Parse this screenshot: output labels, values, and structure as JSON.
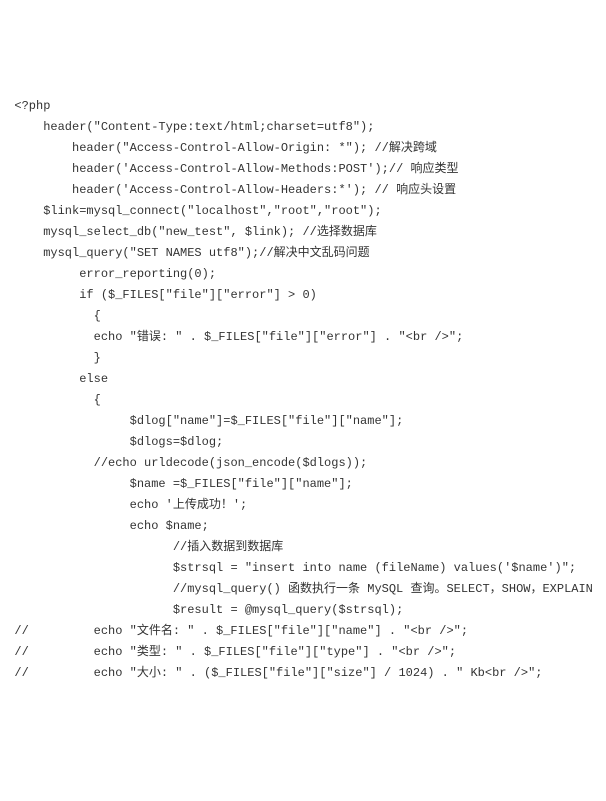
{
  "code": {
    "lines": [
      "  <?php",
      "      header(\"Content-Type:text/html;charset=utf8\");",
      "          header(\"Access-Control-Allow-Origin: *\"); //解决跨域",
      "          header('Access-Control-Allow-Methods:POST');// 响应类型",
      "          header('Access-Control-Allow-Headers:*'); // 响应头设置",
      "      $link=mysql_connect(\"localhost\",\"root\",\"root\");",
      "      mysql_select_db(\"new_test\", $link); //选择数据库",
      "      mysql_query(\"SET NAMES utf8\");//解决中文乱码问题",
      "           error_reporting(0);",
      "           if ($_FILES[\"file\"][\"error\"] > 0)",
      "             {",
      "             echo \"错误: \" . $_FILES[\"file\"][\"error\"] . \"<br />\";",
      "             }",
      "           else",
      "             {",
      "                  $dlog[\"name\"]=$_FILES[\"file\"][\"name\"];",
      "                  $dlogs=$dlog;",
      "             //echo urldecode(json_encode($dlogs));",
      "                  $name =$_FILES[\"file\"][\"name\"];",
      "                  echo '上传成功！';",
      "                  echo $name;",
      "                        //插入数据到数据库",
      "                        $strsql = \"insert into name (fileName) values('$name')\";",
      "                        //mysql_query() 函数执行一条 MySQL 查询。SELECT，SHOW，EXPLAIN",
      "                        $result = @mysql_query($strsql);",
      "  //         echo \"文件名: \" . $_FILES[\"file\"][\"name\"] . \"<br />\";",
      "  //         echo \"类型: \" . $_FILES[\"file\"][\"type\"] . \"<br />\";",
      "  //         echo \"大小: \" . ($_FILES[\"file\"][\"size\"] / 1024) . \" Kb<br />\";"
    ]
  }
}
